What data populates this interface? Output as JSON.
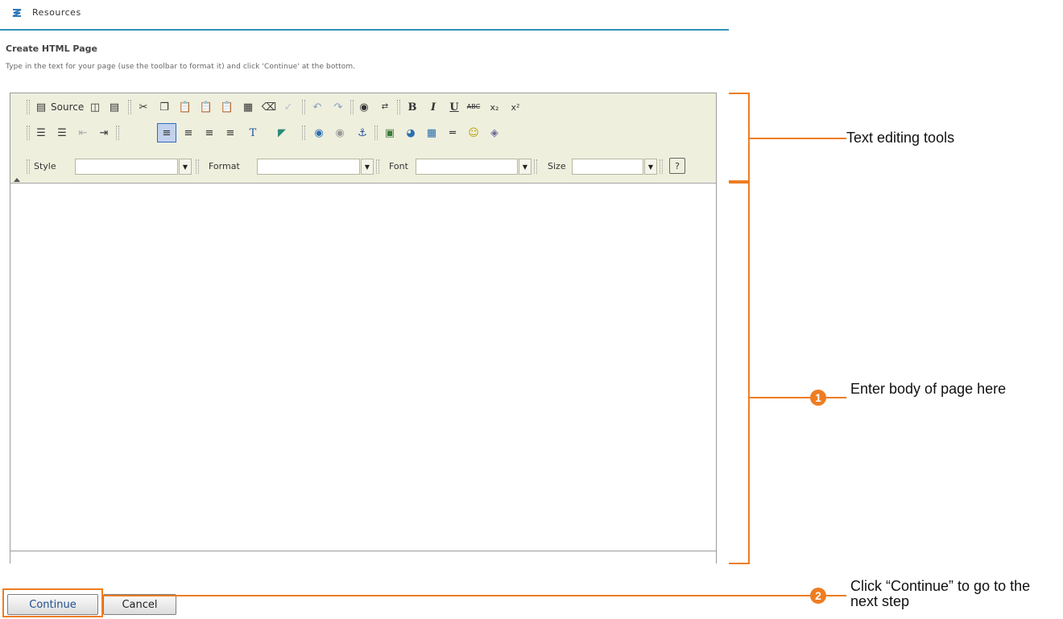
{
  "header": {
    "app_title": "Resources"
  },
  "page": {
    "title": "Create HTML Page",
    "instructions": "Type in the text for your page (use the toolbar to format it) and click 'Continue' at the bottom."
  },
  "toolbar": {
    "source_label": "Source",
    "style_label": "Style",
    "format_label": "Format",
    "font_label": "Font",
    "size_label": "Size",
    "style_value": "",
    "format_value": "",
    "font_value": "",
    "size_value": ""
  },
  "editor": {
    "content": ""
  },
  "buttons": {
    "continue": "Continue",
    "cancel": "Cancel"
  },
  "annotations": {
    "toolbar_note": "Text editing tools",
    "body_badge": "1",
    "body_note": "Enter body of page here",
    "continue_badge": "2",
    "continue_note": "Click “Continue” to go to the next step"
  },
  "colors": {
    "accent": "#ee7d22",
    "header_rule": "#2f93b8",
    "toolbar_bg": "#efefde"
  }
}
